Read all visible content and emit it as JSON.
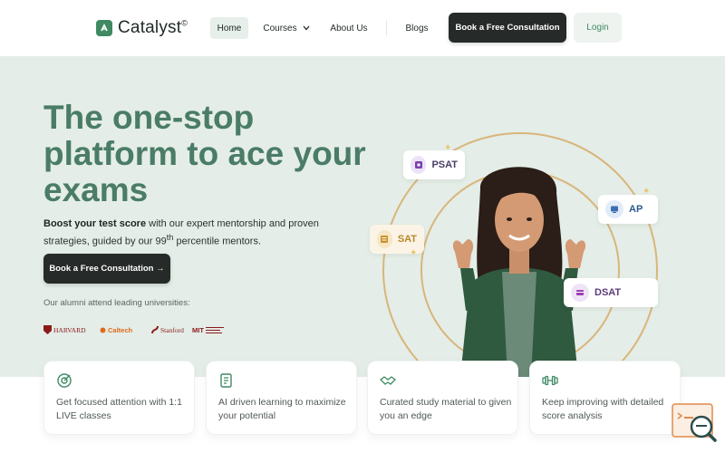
{
  "nav": {
    "logo_text": "Catalyst",
    "logo_sup": "©",
    "home": "Home",
    "courses": "Courses",
    "about": "About Us",
    "blogs": "Blogs",
    "cta": "Book a Free Consultation",
    "login": "Login"
  },
  "hero": {
    "headline": "The one-stop platform to ace your exams",
    "sub_bold": "Boost your test score",
    "sub_rest_1": " with our expert mentorship and proven strategies, guided by our 99",
    "sub_sup": "th",
    "sub_rest_2": " percentile mentors.",
    "cta": "Book a Free Consultation →",
    "alumni": "Our alumni attend leading universities:",
    "universities": {
      "harvard": "HARVARD",
      "caltech": "Caltech",
      "stanford": "Stanford",
      "mit": "MIT"
    }
  },
  "tags": {
    "psat": "PSAT",
    "ap": "AP",
    "sat": "SAT",
    "dsat": "DSAT"
  },
  "features": [
    {
      "text": "Get focused attention with 1:1 LIVE classes",
      "icon": "target-icon"
    },
    {
      "text": "AI driven learning to maximize your potential",
      "icon": "document-icon"
    },
    {
      "text": "Curated study material to given you an edge",
      "icon": "handshake-icon"
    },
    {
      "text": "Keep improving with detailed score analysis",
      "icon": "dumbbell-icon"
    }
  ],
  "colors": {
    "brand_green": "#3f8a63",
    "headline_green": "#4a7c67",
    "hero_bg": "#e4ede7",
    "ring_gold": "#d9b57a",
    "dark_button": "#262a28"
  }
}
